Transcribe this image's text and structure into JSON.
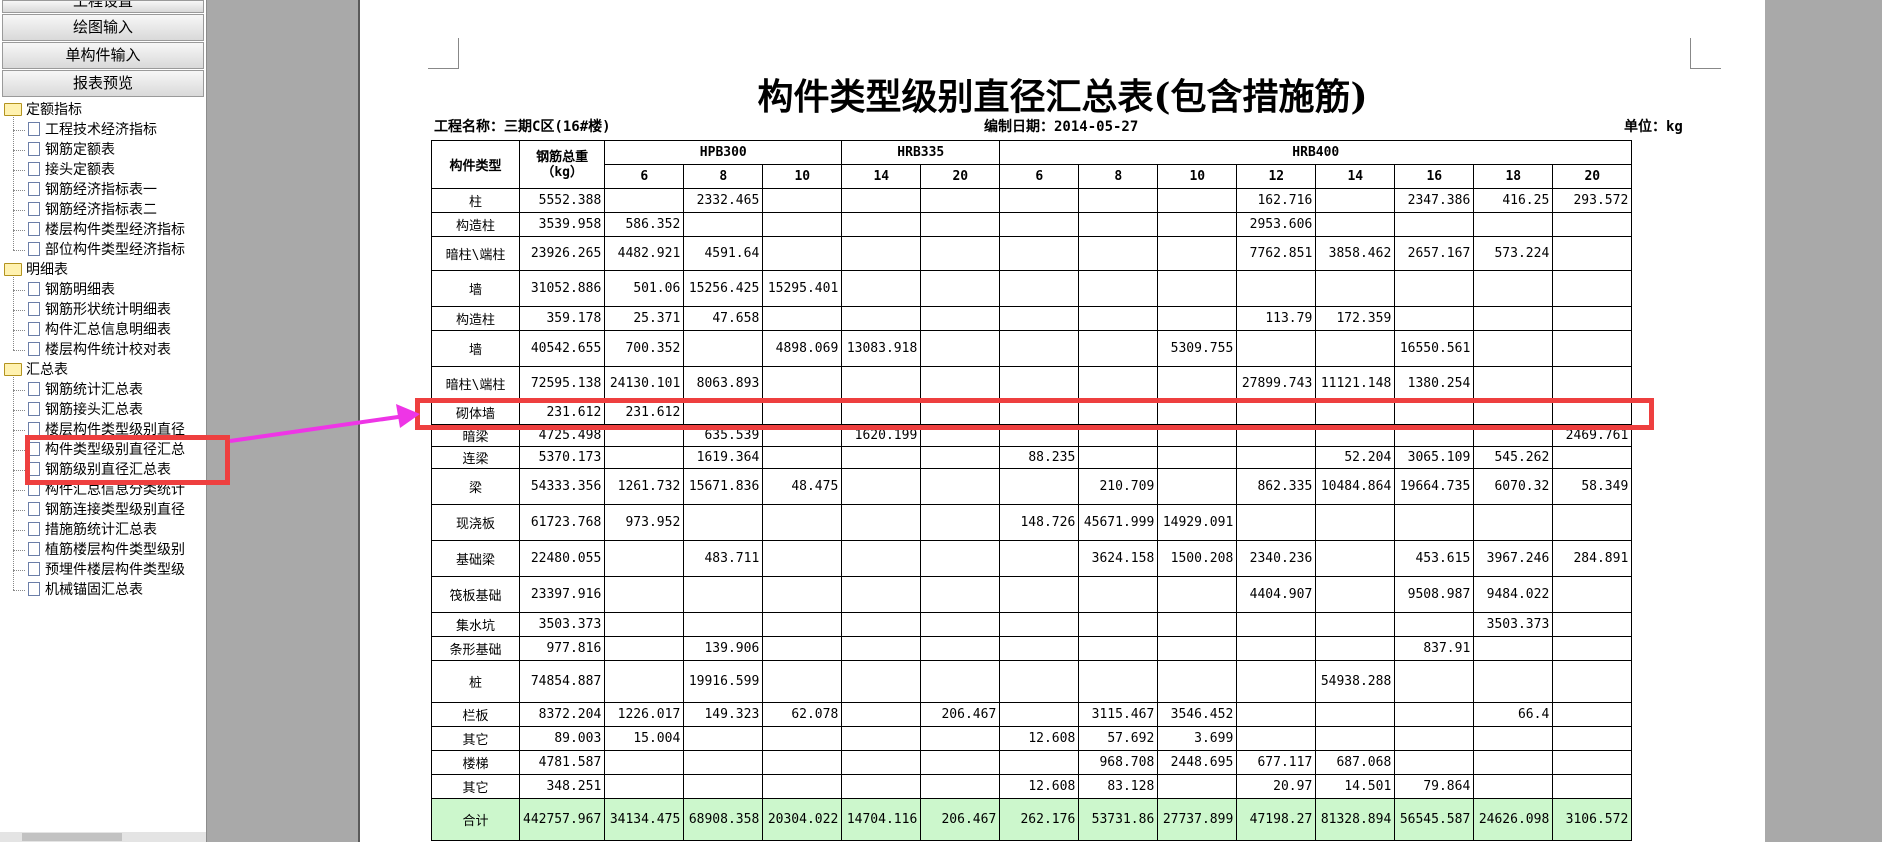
{
  "nav_buttons": [
    "工程设置",
    "绘图输入",
    "单构件输入",
    "报表预览"
  ],
  "tree": [
    {
      "type": "folder",
      "label": "定额指标"
    },
    {
      "type": "leaf",
      "label": "工程技术经济指标"
    },
    {
      "type": "leaf",
      "label": "钢筋定额表"
    },
    {
      "type": "leaf",
      "label": "接头定额表"
    },
    {
      "type": "leaf",
      "label": "钢筋经济指标表一"
    },
    {
      "type": "leaf",
      "label": "钢筋经济指标表二"
    },
    {
      "type": "leaf",
      "label": "楼层构件类型经济指标"
    },
    {
      "type": "leaf",
      "label": "部位构件类型经济指标"
    },
    {
      "type": "folder",
      "label": "明细表"
    },
    {
      "type": "leaf",
      "label": "钢筋明细表"
    },
    {
      "type": "leaf",
      "label": "钢筋形状统计明细表"
    },
    {
      "type": "leaf",
      "label": "构件汇总信息明细表"
    },
    {
      "type": "leaf",
      "label": "楼层构件统计校对表"
    },
    {
      "type": "folder",
      "label": "汇总表"
    },
    {
      "type": "leaf",
      "label": "钢筋统计汇总表"
    },
    {
      "type": "leaf",
      "label": "钢筋接头汇总表"
    },
    {
      "type": "leaf",
      "label": "楼层构件类型级别直径"
    },
    {
      "type": "leaf",
      "label": "构件类型级别直径汇总"
    },
    {
      "type": "leaf",
      "label": "钢筋级别直径汇总表"
    },
    {
      "type": "leaf",
      "label": "构件汇总信息分类统计"
    },
    {
      "type": "leaf",
      "label": "钢筋连接类型级别直径"
    },
    {
      "type": "leaf",
      "label": "措施筋统计汇总表"
    },
    {
      "type": "leaf",
      "label": "植筋楼层构件类型级别"
    },
    {
      "type": "leaf",
      "label": "预埋件楼层构件类型级"
    },
    {
      "type": "leaf",
      "label": "机械锚固汇总表"
    }
  ],
  "report": {
    "title": "构件类型级别直径汇总表(包含措施筋)",
    "project_label": "工程名称：三期C区(16#楼)",
    "date_label": "编制日期：2014-05-27",
    "unit_label": "单位：kg",
    "header": {
      "type_col": "构件类型",
      "total_col": "钢筋总重（kg）",
      "groups": [
        {
          "name": "HPB300",
          "span": 3
        },
        {
          "name": "HRB335",
          "span": 2
        },
        {
          "name": "HRB400",
          "span": 8
        }
      ],
      "diameters": [
        "6",
        "8",
        "10",
        "14",
        "20",
        "6",
        "8",
        "10",
        "12",
        "14",
        "16",
        "18",
        "20"
      ]
    },
    "rows": [
      {
        "type": "柱",
        "total": "5552.388",
        "cells": [
          "",
          "2332.465",
          "",
          "",
          "",
          "",
          "",
          "",
          "162.716",
          "",
          "2347.386",
          "416.25",
          "293.572"
        ],
        "h": 24
      },
      {
        "type": "构造柱",
        "total": "3539.958",
        "cells": [
          "586.352",
          "",
          "",
          "",
          "",
          "",
          "",
          "",
          "2953.606",
          "",
          "",
          "",
          ""
        ],
        "h": 24
      },
      {
        "type": "暗柱\\端柱",
        "total": "23926.265",
        "cells": [
          "4482.921",
          "4591.64",
          "",
          "",
          "",
          "",
          "",
          "",
          "7762.851",
          "3858.462",
          "2657.167",
          "573.224",
          ""
        ],
        "h": 34
      },
      {
        "type": "墙",
        "total": "31052.886",
        "cells": [
          "501.06",
          "15256.425",
          "15295.401",
          "",
          "",
          "",
          "",
          "",
          "",
          "",
          "",
          "",
          ""
        ],
        "h": 36
      },
      {
        "type": "构造柱",
        "total": "359.178",
        "cells": [
          "25.371",
          "47.658",
          "",
          "",
          "",
          "",
          "",
          "",
          "113.79",
          "172.359",
          "",
          "",
          ""
        ],
        "h": 24
      },
      {
        "type": "墙",
        "total": "40542.655",
        "cells": [
          "700.352",
          "",
          "4898.069",
          "13083.918",
          "",
          "",
          "",
          "5309.755",
          "",
          "",
          "16550.561",
          "",
          ""
        ],
        "h": 36
      },
      {
        "type": "暗柱\\端柱",
        "total": "72595.138",
        "cells": [
          "24130.101",
          "8063.893",
          "",
          "",
          "",
          "",
          "",
          "",
          "27899.743",
          "11121.148",
          "1380.254",
          "",
          ""
        ],
        "h": 34
      },
      {
        "type": "砌体墙",
        "total": "231.612",
        "cells": [
          "231.612",
          "",
          "",
          "",
          "",
          "",
          "",
          "",
          "",
          "",
          "",
          "",
          ""
        ],
        "h": 24
      },
      {
        "type": "暗梁",
        "total": "4725.498",
        "cells": [
          "",
          "635.539",
          "",
          "1620.199",
          "",
          "",
          "",
          "",
          "",
          "",
          "",
          "",
          "2469.761"
        ],
        "h": 22
      },
      {
        "type": "连梁",
        "total": "5370.173",
        "cells": [
          "",
          "1619.364",
          "",
          "",
          "",
          "88.235",
          "",
          "",
          "",
          "52.204",
          "3065.109",
          "545.262",
          ""
        ],
        "h": 22
      },
      {
        "type": "梁",
        "total": "54333.356",
        "cells": [
          "1261.732",
          "15671.836",
          "48.475",
          "",
          "",
          "",
          "210.709",
          "",
          "862.335",
          "10484.864",
          "19664.735",
          "6070.32",
          "58.349"
        ],
        "h": 36
      },
      {
        "type": "现浇板",
        "total": "61723.768",
        "cells": [
          "973.952",
          "",
          "",
          "",
          "",
          "148.726",
          "45671.999",
          "14929.091",
          "",
          "",
          "",
          "",
          ""
        ],
        "h": 36
      },
      {
        "type": "基础梁",
        "total": "22480.055",
        "cells": [
          "",
          "483.711",
          "",
          "",
          "",
          "",
          "3624.158",
          "1500.208",
          "2340.236",
          "",
          "453.615",
          "3967.246",
          "284.891"
        ],
        "h": 36
      },
      {
        "type": "筏板基础",
        "total": "23397.916",
        "cells": [
          "",
          "",
          "",
          "",
          "",
          "",
          "",
          "",
          "4404.907",
          "",
          "9508.987",
          "9484.022",
          ""
        ],
        "h": 36
      },
      {
        "type": "集水坑",
        "total": "3503.373",
        "cells": [
          "",
          "",
          "",
          "",
          "",
          "",
          "",
          "",
          "",
          "",
          "",
          "3503.373",
          ""
        ],
        "h": 24
      },
      {
        "type": "条形基础",
        "total": "977.816",
        "cells": [
          "",
          "139.906",
          "",
          "",
          "",
          "",
          "",
          "",
          "",
          "",
          "837.91",
          "",
          ""
        ],
        "h": 24
      },
      {
        "type": "桩",
        "total": "74854.887",
        "cells": [
          "",
          "19916.599",
          "",
          "",
          "",
          "",
          "",
          "",
          "",
          "54938.288",
          "",
          "",
          ""
        ],
        "h": 42
      },
      {
        "type": "栏板",
        "total": "8372.204",
        "cells": [
          "1226.017",
          "149.323",
          "62.078",
          "",
          "206.467",
          "",
          "3115.467",
          "3546.452",
          "",
          "",
          "",
          "66.4",
          ""
        ],
        "h": 24
      },
      {
        "type": "其它",
        "total": "89.003",
        "cells": [
          "15.004",
          "",
          "",
          "",
          "",
          "12.608",
          "57.692",
          "3.699",
          "",
          "",
          "",
          "",
          ""
        ],
        "h": 24
      },
      {
        "type": "楼梯",
        "total": "4781.587",
        "cells": [
          "",
          "",
          "",
          "",
          "",
          "",
          "968.708",
          "2448.695",
          "677.117",
          "687.068",
          "",
          "",
          ""
        ],
        "h": 24
      },
      {
        "type": "其它",
        "total": "348.251",
        "cells": [
          "",
          "",
          "",
          "",
          "",
          "12.608",
          "83.128",
          "",
          "20.97",
          "14.501",
          "79.864",
          "",
          ""
        ],
        "h": 24
      }
    ],
    "total_row": {
      "type": "合计",
      "total": "442757.967",
      "cells": [
        "34134.475",
        "68908.358",
        "20304.022",
        "14704.116",
        "206.467",
        "262.176",
        "53731.86",
        "27737.899",
        "47198.27",
        "81328.894",
        "56545.587",
        "24626.098",
        "3106.572"
      ],
      "h": 42
    }
  },
  "colors": {
    "highlight": "#ee3f3f",
    "arrow": "#ee35e6",
    "total_row_bg": "#ccf7cc",
    "background": "#a9a9a9"
  }
}
